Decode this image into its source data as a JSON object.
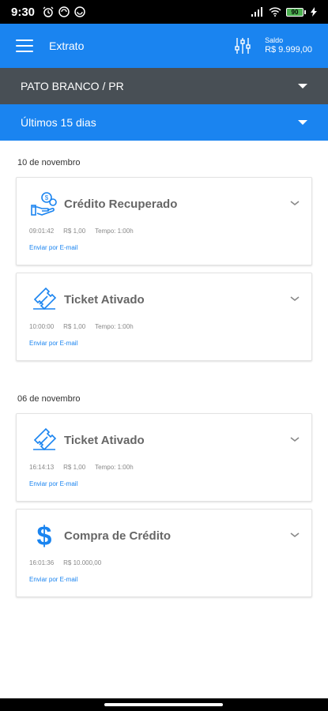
{
  "status_bar": {
    "time": "9:30",
    "battery": "90"
  },
  "header": {
    "title": "Extrato",
    "saldo_label": "Saldo",
    "saldo_value": "R$ 9.999,00"
  },
  "city_selector": {
    "label": "PATO BRANCO / PR"
  },
  "period_selector": {
    "label": "Últimos 15 dias"
  },
  "groups": [
    {
      "date": "10 de novembro",
      "items": [
        {
          "icon": "hand-coins-icon",
          "title": "Crédito Recuperado",
          "time": "09:01:42",
          "value": "R$ 1,00",
          "duration": "Tempo: 1:00h",
          "link": "Enviar por E-mail"
        },
        {
          "icon": "ticket-icon",
          "title": "Ticket Ativado",
          "time": "10:00:00",
          "value": "R$ 1,00",
          "duration": "Tempo: 1:00h",
          "link": "Enviar por E-mail"
        }
      ]
    },
    {
      "date": "06 de novembro",
      "items": [
        {
          "icon": "ticket-icon",
          "title": "Ticket Ativado",
          "time": "16:14:13",
          "value": "R$ 1,00",
          "duration": "Tempo: 1:00h",
          "link": "Enviar por E-mail"
        },
        {
          "icon": "dollar-icon",
          "title": "Compra de Crédito",
          "time": "16:01:36",
          "value": "R$ 10.000,00",
          "duration": "",
          "link": "Enviar por E-mail"
        }
      ]
    }
  ],
  "colors": {
    "primary": "#1a84f0",
    "city_bar": "#484f55"
  }
}
